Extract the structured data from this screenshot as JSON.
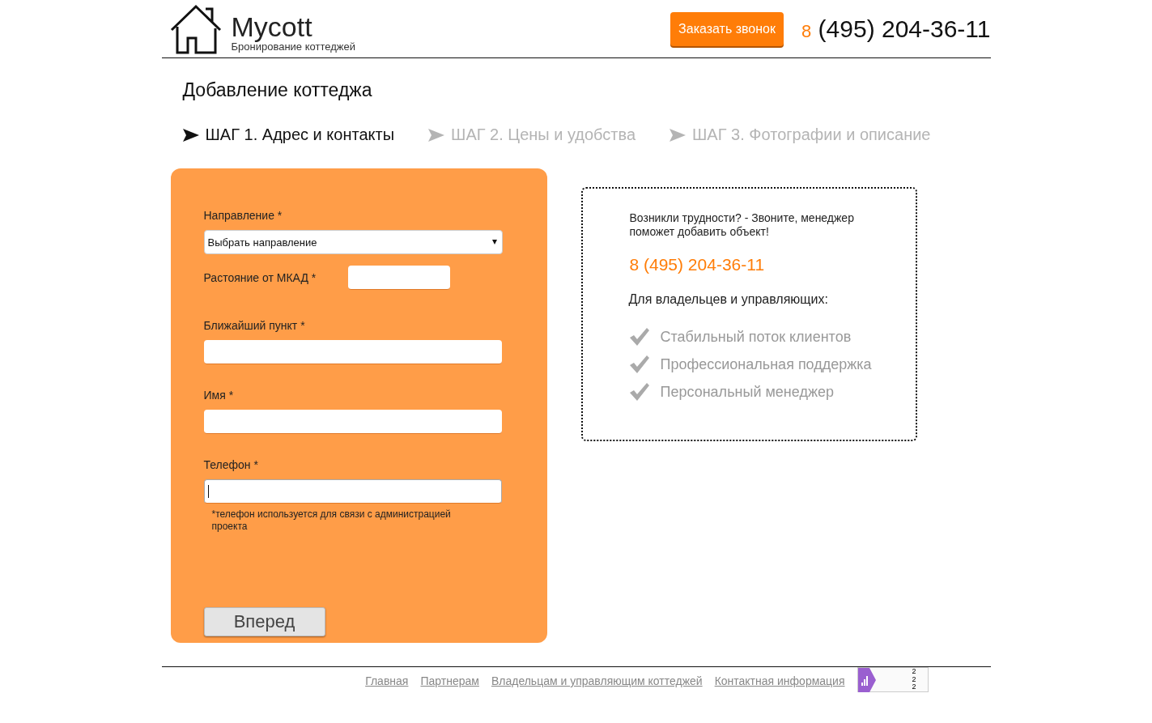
{
  "header": {
    "logo_title": "Mycott",
    "logo_subtitle": "Бронирование коттеджей",
    "callback_button": "Заказать звонок",
    "phone_prefix": "8",
    "phone": "(495) 204-36-11"
  },
  "page_title": "Добавление коттеджа",
  "steps": [
    {
      "label": "ШАГ 1. Адрес и контакты",
      "selected": true
    },
    {
      "label": "ШАГ 2. Цены и удобства",
      "selected": false
    },
    {
      "label": "ШАГ 3. Фотографии и описание",
      "selected": false
    }
  ],
  "form": {
    "fields": [
      {
        "kind": "select",
        "label": "Направление *",
        "value": "Выбрать направление"
      },
      {
        "kind": "short",
        "label": "Растояние от МКАД *"
      },
      {
        "kind": "text",
        "label": "Ближайший пункт *",
        "focused": false
      },
      {
        "kind": "text",
        "label": "Имя *",
        "focused": false
      },
      {
        "kind": "text",
        "label": "Телефон *",
        "focused": true,
        "note": "*телефон используется для связи с администрацией проекта"
      }
    ],
    "submit": "Вперед"
  },
  "help": {
    "text": "Возникли трудности? - Звоните, менеджер поможет добавить объект!",
    "phone": "8 (495) 204-36-11",
    "subtitle": "Для владельцев и управляющих:",
    "benefits": [
      "Стабильный поток клиентов",
      "Профессиональная поддержка",
      "Персональный менеджер"
    ]
  },
  "footer": {
    "links": [
      "Главная",
      "Партнерам",
      "Владельцам и управляющим коттеджей",
      "Контактная информация"
    ],
    "counter": [
      "2",
      "2",
      "2"
    ]
  }
}
